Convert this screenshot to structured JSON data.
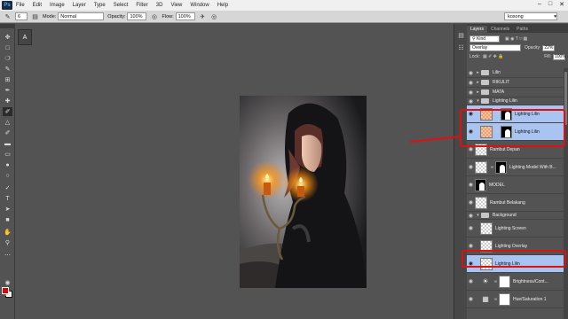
{
  "menubar": {
    "logo": "Ps",
    "items": [
      "File",
      "Edit",
      "Image",
      "Layer",
      "Type",
      "Select",
      "Filter",
      "3D",
      "View",
      "Window",
      "Help"
    ]
  },
  "options": {
    "brush_size": "6",
    "mode_label": "Mode:",
    "mode_value": "Normal",
    "opacity_label": "Opacity:",
    "opacity_value": "100%",
    "flow_label": "Flow:",
    "flow_value": "100%",
    "workspace": "kosong"
  },
  "colors": {
    "foreground": "#e60000",
    "background": "#ffffff",
    "annotation": "#e01010"
  },
  "layers_panel": {
    "tabs": [
      "Layers",
      "Channels",
      "Paths"
    ],
    "filter_kind": "Kind",
    "blend_mode": "Overlay",
    "opacity_label": "Opacity:",
    "opacity_value": "22%",
    "lock_label": "Lock:",
    "fill_label": "Fill:",
    "fill_value": "100%",
    "layers": [
      {
        "name": "Lilin",
        "kind": "group-collapsed"
      },
      {
        "name": "RIKULIT",
        "kind": "group-collapsed"
      },
      {
        "name": "MATA",
        "kind": "group-collapsed"
      },
      {
        "name": "Lighting Lilin",
        "kind": "group-open"
      },
      {
        "name": "Lighting Lilin",
        "kind": "masked-selected"
      },
      {
        "name": "Lighting Lilin",
        "kind": "masked-selected"
      },
      {
        "name": "Rambut Depan",
        "kind": "layer"
      },
      {
        "name": "Lighting Model With B...",
        "kind": "masked"
      },
      {
        "name": "MODEL",
        "kind": "masked-dark"
      },
      {
        "name": "Rambut Belakang",
        "kind": "layer"
      },
      {
        "name": "Background",
        "kind": "group-open"
      },
      {
        "name": "Lighting Screen",
        "kind": "layer"
      },
      {
        "name": "Lighting Overlay",
        "kind": "layer"
      },
      {
        "name": "Lighting Lilin",
        "kind": "selected"
      },
      {
        "name": "Brightness/Cont...",
        "kind": "adjustment-brightness"
      },
      {
        "name": "Hue/Saturation 1",
        "kind": "adjustment-hue"
      }
    ]
  }
}
